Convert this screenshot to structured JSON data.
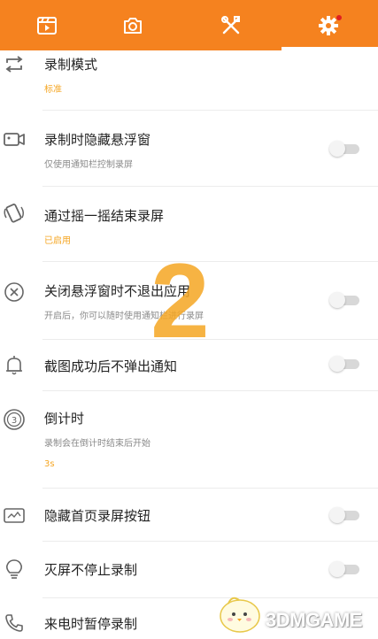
{
  "tabs": [
    {
      "name": "video-icon"
    },
    {
      "name": "camera-icon"
    },
    {
      "name": "tools-icon"
    },
    {
      "name": "gear-icon",
      "active": true,
      "badge": true
    }
  ],
  "settings": {
    "record_mode": {
      "title": "录制模式",
      "value": "标准"
    },
    "hide_float": {
      "title": "录制时隐藏悬浮窗",
      "subtitle": "仅使用通知栏控制录屏",
      "on": false
    },
    "shake_stop": {
      "title": "通过摇一摇结束录屏",
      "value": "已启用"
    },
    "close_float": {
      "title": "关闭悬浮窗时不退出应用",
      "subtitle": "开启后，你可以随时使用通知栏进行录屏",
      "on": false
    },
    "no_notify": {
      "title": "截图成功后不弹出通知",
      "on": false
    },
    "countdown": {
      "title": "倒计时",
      "subtitle": "录制会在倒计时结束后开始",
      "value": "3s"
    },
    "hide_button": {
      "title": "隐藏首页录屏按钮",
      "on": false
    },
    "screen_off": {
      "title": "灭屏不停止录制",
      "on": false
    },
    "call_pause": {
      "title": "来电时暂停录制"
    }
  },
  "watermark": {
    "text": "3DMGAME",
    "number": "2"
  }
}
